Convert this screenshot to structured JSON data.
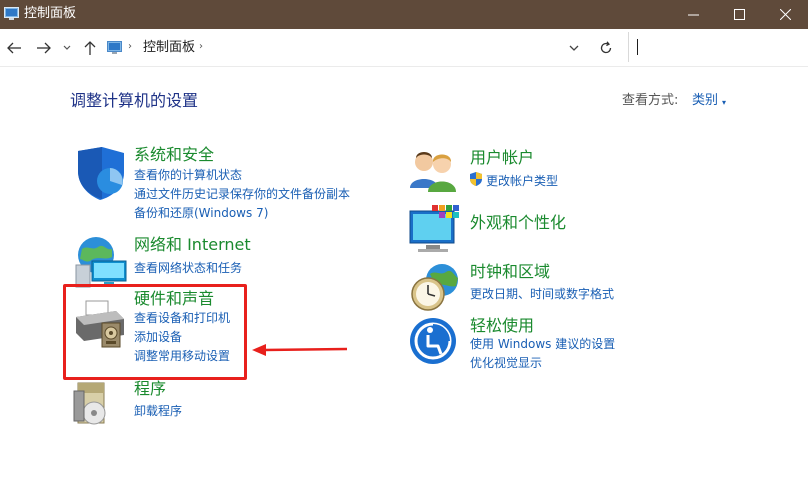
{
  "window": {
    "title": "控制面板"
  },
  "address": {
    "breadcrumb": "控制面板",
    "search_placeholder": ""
  },
  "header": {
    "page_title": "调整计算机的设置",
    "view_by_label": "查看方式:",
    "view_by_value": "类别"
  },
  "categories": [
    {
      "title": "系统和安全",
      "icon": "shield-icon",
      "links": [
        "查看你的计算机状态",
        "通过文件历史记录保存你的文件备份副本",
        "备份和还原(Windows 7)"
      ]
    },
    {
      "title": "网络和 Internet",
      "icon": "network-globe-icon",
      "links": [
        "查看网络状态和任务"
      ]
    },
    {
      "title": "硬件和声音",
      "icon": "printer-icon",
      "links": [
        "查看设备和打印机",
        "添加设备",
        "调整常用移动设置"
      ]
    },
    {
      "title": "程序",
      "icon": "programs-icon",
      "links": [
        "卸载程序"
      ]
    },
    {
      "title": "用户帐户",
      "icon": "users-icon",
      "links": [
        "更改帐户类型"
      ]
    },
    {
      "title": "外观和个性化",
      "icon": "monitor-palette-icon",
      "links": []
    },
    {
      "title": "时钟和区域",
      "icon": "clock-globe-icon",
      "links": [
        "更改日期、时间或数字格式"
      ]
    },
    {
      "title": "轻松使用",
      "icon": "ease-of-access-icon",
      "links": [
        "使用 Windows 建议的设置",
        "优化视觉显示"
      ]
    }
  ],
  "colors": {
    "titlebar": "#5f4a3a",
    "category_title": "#1a8a2e",
    "link": "#1a5fb4",
    "page_title": "#1e3287",
    "annotation": "#e8201c"
  }
}
